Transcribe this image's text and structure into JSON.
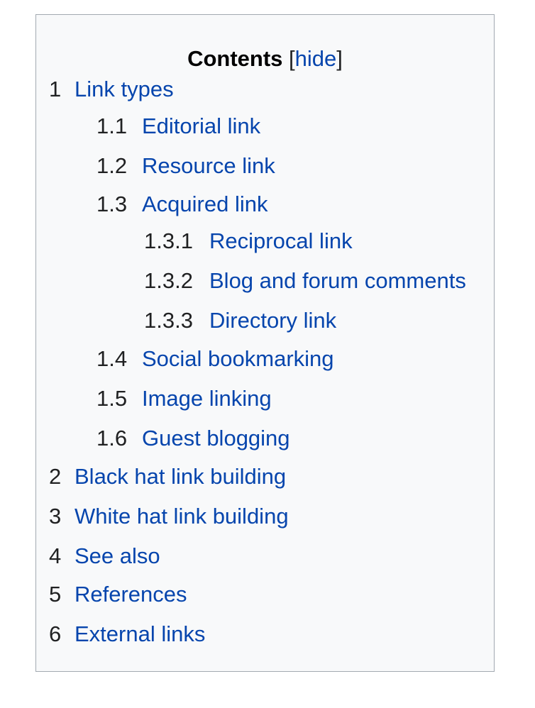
{
  "toc": {
    "title": "Contents",
    "toggle_open": "[",
    "toggle_label": "hide",
    "toggle_close": "]",
    "link_color": "#0645ad",
    "items": [
      {
        "number": "1",
        "text": "Link types",
        "level": 1
      },
      {
        "number": "1.1",
        "text": "Editorial link",
        "level": 2
      },
      {
        "number": "1.2",
        "text": "Resource link",
        "level": 2
      },
      {
        "number": "1.3",
        "text": "Acquired link",
        "level": 2
      },
      {
        "number": "1.3.1",
        "text": "Reciprocal link",
        "level": 3
      },
      {
        "number": "1.3.2",
        "text": "Blog and forum comments",
        "level": 3
      },
      {
        "number": "1.3.3",
        "text": "Directory link",
        "level": 3
      },
      {
        "number": "1.4",
        "text": "Social bookmarking",
        "level": 2
      },
      {
        "number": "1.5",
        "text": "Image linking",
        "level": 2
      },
      {
        "number": "1.6",
        "text": "Guest blogging",
        "level": 2
      },
      {
        "number": "2",
        "text": "Black hat link building",
        "level": 1
      },
      {
        "number": "3",
        "text": "White hat link building",
        "level": 1
      },
      {
        "number": "4",
        "text": "See also",
        "level": 1
      },
      {
        "number": "5",
        "text": "References",
        "level": 1
      },
      {
        "number": "6",
        "text": "External links",
        "level": 1
      }
    ]
  }
}
